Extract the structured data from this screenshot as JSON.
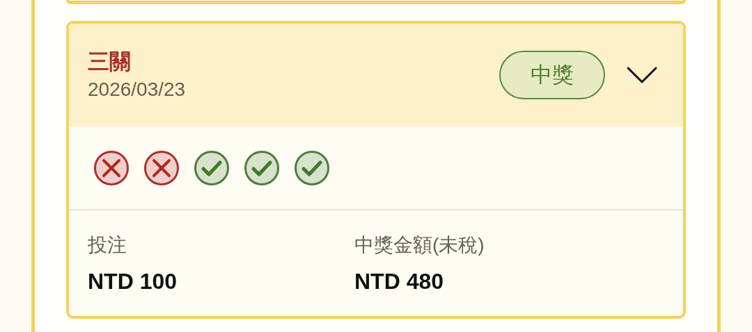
{
  "ticket": {
    "title": "三關",
    "date": "2026/03/23",
    "badge": {
      "label": "中獎",
      "kind": "won"
    },
    "expanded": true,
    "legs": [
      {
        "kind": "miss"
      },
      {
        "kind": "miss"
      },
      {
        "kind": "hit"
      },
      {
        "kind": "hit"
      },
      {
        "kind": "hit"
      }
    ],
    "summary": [
      {
        "label": "投注",
        "value": "NTD 100"
      },
      {
        "label": "中獎金額(未稅)",
        "value": "NTD 480"
      }
    ]
  }
}
